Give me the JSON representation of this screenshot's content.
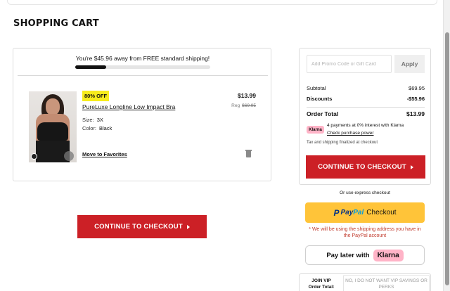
{
  "page": {
    "title": "SHOPPING CART"
  },
  "shipping": {
    "message": "You're $45.96 away from FREE standard shipping!",
    "progress_percent": 23
  },
  "cart_item": {
    "badge": "80% OFF",
    "name": "PureLuxe Longline Low Impact Bra",
    "size_label": "Size:",
    "size_value": "3X",
    "color_label": "Color:",
    "color_value": "Black",
    "price": "$13.99",
    "reg_label": "Reg",
    "reg_price": "$69.95",
    "move_label": "Move to Favorites",
    "image_icon": "product-photo",
    "delete_icon": "trash-icon"
  },
  "checkout_main": {
    "label": "CONTINUE TO CHECKOUT",
    "icon": "chevron-right-icon"
  },
  "summary": {
    "promo_placeholder": "Add Promo Code or Gift Card",
    "apply_label": "Apply",
    "subtotal_label": "Subtotal",
    "subtotal_value": "$69.95",
    "discounts_label": "Discounts",
    "discounts_value": "-$55.96",
    "total_label": "Order Total",
    "total_value": "$13.99",
    "klarna_logo": "Klarna",
    "klarna_text": "4 payments at 0% interest with Klarna",
    "klarna_link": "Check purchase power",
    "tax_note": "Tax and shipping finalized at checkout",
    "checkout_label": "CONTINUE TO CHECKOUT"
  },
  "express": {
    "label": "Or use express checkout",
    "paypal_pay": "Pay",
    "paypal_pal": "Pal",
    "paypal_checkout": "Checkout",
    "paypal_note": "* We will be using the shipping address you have in the PayPal account",
    "paylater_label": "Pay later with",
    "paylater_klarna": "Klarna"
  },
  "vip": {
    "line1": "JOIN VIP",
    "line2": "Order Total:",
    "option": "NO, I DO NOT WANT VIP SAVINGS OR PERKS"
  },
  "colors": {
    "brand_red": "#cc2026",
    "badge_yellow": "#f7ec1c",
    "paypal_yellow": "#ffc439",
    "klarna_pink": "#ffb3c7"
  }
}
